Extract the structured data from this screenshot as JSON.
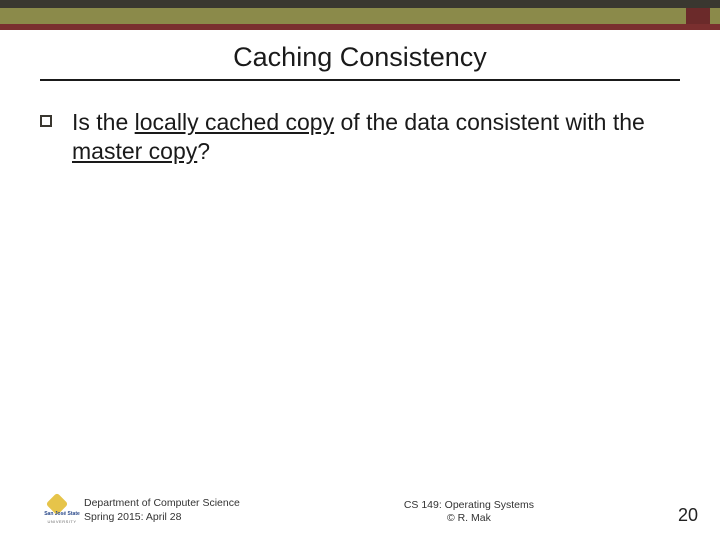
{
  "title": "Caching Consistency",
  "bullet": {
    "prefix": "Is the ",
    "u1": "locally cached copy",
    "mid": " of the data consistent with the ",
    "u2": "master copy",
    "suffix": "?"
  },
  "footer": {
    "dept": "Department of Computer Science",
    "term": "Spring 2015: April 28",
    "course": "CS 149: Operating Systems",
    "author": "© R. Mak",
    "page": "20",
    "logo_name": "San José State",
    "logo_sub": "UNIVERSITY"
  }
}
